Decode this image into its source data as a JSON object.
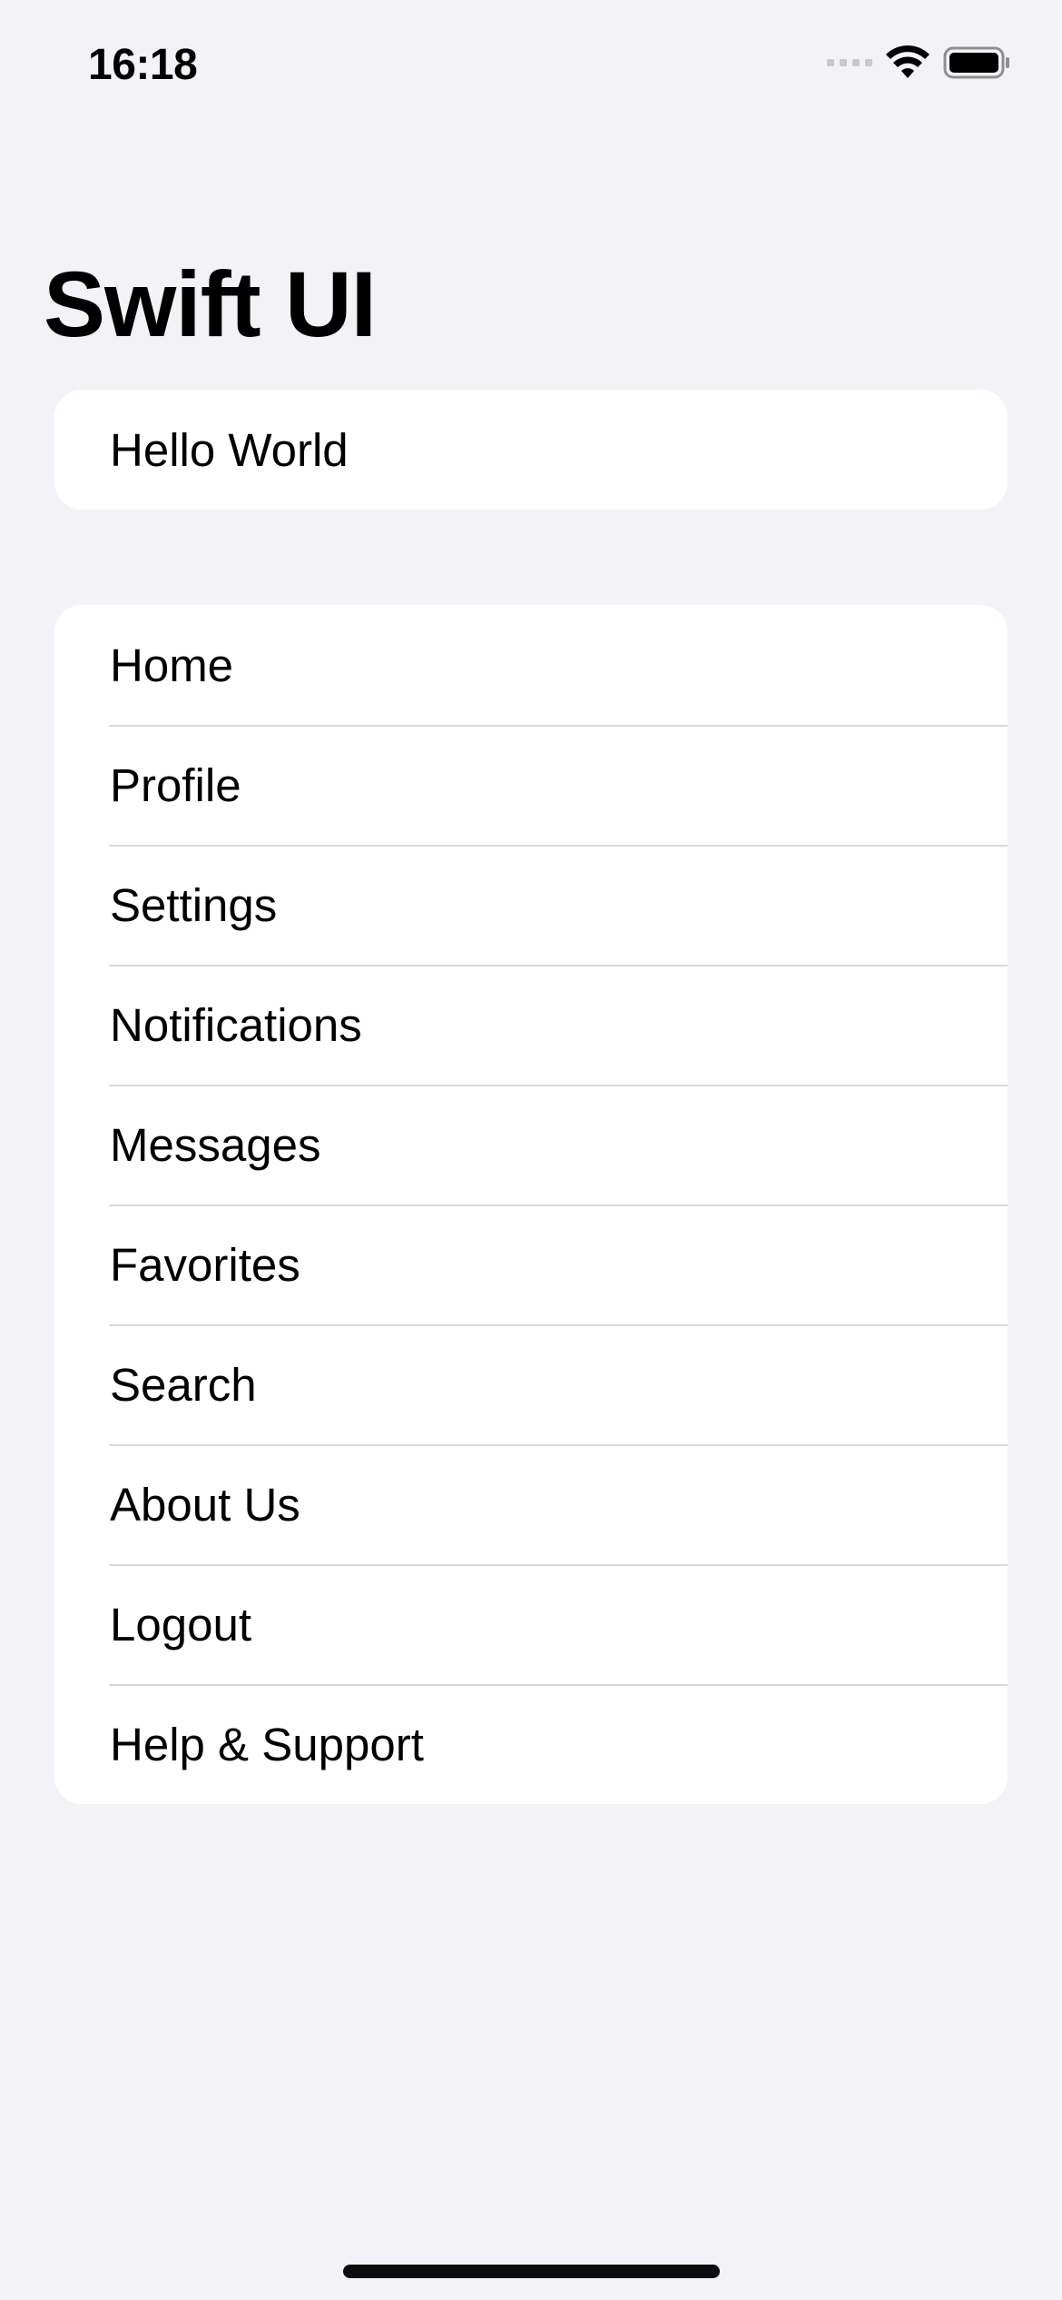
{
  "status_bar": {
    "time": "16:18",
    "icons": [
      "cellular-signal-icon",
      "wifi-icon",
      "battery-icon"
    ]
  },
  "navigation": {
    "title": "Swift UI"
  },
  "hello_section": {
    "text": "Hello World"
  },
  "menu": {
    "items": [
      {
        "label": "Home"
      },
      {
        "label": "Profile"
      },
      {
        "label": "Settings"
      },
      {
        "label": "Notifications"
      },
      {
        "label": "Messages"
      },
      {
        "label": "Favorites"
      },
      {
        "label": "Search"
      },
      {
        "label": "About Us"
      },
      {
        "label": "Logout"
      },
      {
        "label": "Help & Support"
      }
    ]
  },
  "colors": {
    "background": "#f2f2f7",
    "card": "#ffffff",
    "separator": "#d8d8dc",
    "text": "#000000"
  }
}
